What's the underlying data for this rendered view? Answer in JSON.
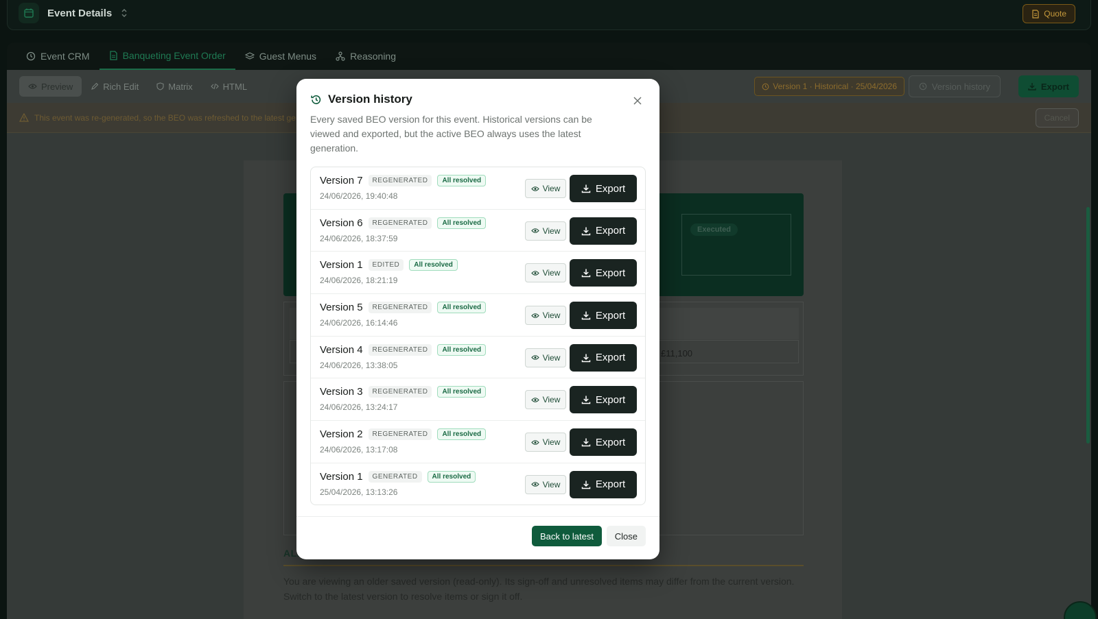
{
  "header": {
    "title": "Event Details",
    "quote_label": "Quote"
  },
  "tabs": [
    {
      "label": "Event CRM"
    },
    {
      "label": "Banqueting Event Order"
    },
    {
      "label": "Guest Menus"
    },
    {
      "label": "Reasoning"
    }
  ],
  "toolbar": {
    "modes": [
      {
        "label": "Preview"
      },
      {
        "label": "Rich Edit"
      },
      {
        "label": "Matrix"
      },
      {
        "label": "HTML"
      }
    ],
    "historical_badge": "Version 1 · Historical · 25/04/2026",
    "version_history_label": "Version history",
    "export_label": "Export"
  },
  "notice": {
    "text": "This event was re-generated, so the BEO was refreshed to the latest ge",
    "cancel_label": "Cancel"
  },
  "document": {
    "executed_label": "Executed",
    "total": "£11,100",
    "allergens_heading": "ALLERGENS",
    "readonly_note": "You are viewing an older saved version (read-only). Its sign-off and unresolved items may differ from the current version. Switch to the latest version to resolve items or sign it off."
  },
  "modal": {
    "title": "Version history",
    "description": "Every saved BEO version for this event. Historical versions can be viewed and exported, but the active BEO always uses the latest generation.",
    "view_label": "View",
    "export_label": "Export",
    "back_label": "Back to latest",
    "close_label": "Close",
    "versions": [
      {
        "name": "Version 7",
        "kind": "REGENERATED",
        "status": "All resolved",
        "time": "24/06/2026, 19:40:48"
      },
      {
        "name": "Version 6",
        "kind": "REGENERATED",
        "status": "All resolved",
        "time": "24/06/2026, 18:37:59"
      },
      {
        "name": "Version 1",
        "kind": "EDITED",
        "status": "All resolved",
        "time": "24/06/2026, 18:21:19"
      },
      {
        "name": "Version 5",
        "kind": "REGENERATED",
        "status": "All resolved",
        "time": "24/06/2026, 16:14:46"
      },
      {
        "name": "Version 4",
        "kind": "REGENERATED",
        "status": "All resolved",
        "time": "24/06/2026, 13:38:05"
      },
      {
        "name": "Version 3",
        "kind": "REGENERATED",
        "status": "All resolved",
        "time": "24/06/2026, 13:24:17"
      },
      {
        "name": "Version 2",
        "kind": "REGENERATED",
        "status": "All resolved",
        "time": "24/06/2026, 13:17:08"
      },
      {
        "name": "Version 1",
        "kind": "GENERATED",
        "status": "All resolved",
        "time": "25/04/2026, 13:13:26"
      }
    ]
  },
  "colors": {
    "brand_green": "#0f5b3c",
    "dark_button": "#1a2421",
    "resolved_green": "#1a6a44"
  }
}
